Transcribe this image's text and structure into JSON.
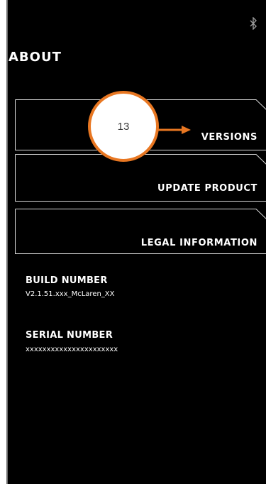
{
  "header": {
    "title": "ABOUT",
    "status_icon": "bluetooth-icon"
  },
  "menu": {
    "items": [
      {
        "label": "VERSIONS"
      },
      {
        "label": "UPDATE PRODUCT"
      },
      {
        "label": "LEGAL INFORMATION"
      }
    ]
  },
  "build": {
    "label": "BUILD NUMBER",
    "value": "V2.1.51.xxx_McLaren_XX"
  },
  "serial": {
    "label": "SERIAL NUMBER",
    "value": "xxxxxxxxxxxxxxxxxxxxxx"
  },
  "callout": {
    "number": "13",
    "accent_color": "#e87722"
  },
  "colors": {
    "background": "#000000",
    "text": "#ffffff",
    "outline": "#d9d9d9"
  }
}
